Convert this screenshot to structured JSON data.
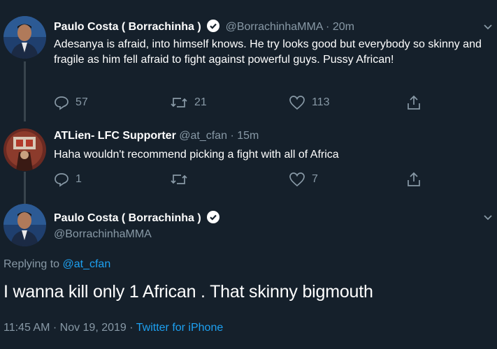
{
  "tweet1": {
    "name": "Paulo Costa ( Borrachinha )",
    "handle": "@BorrachinhaMMA",
    "dot": "·",
    "time": "20m",
    "text": "Adesanya is afraid, into himself knows. He try looks good but everybody so skinny and fragile as him fell afraid to fight against powerful guys. Pussy African!",
    "replies": "57",
    "retweets": "21",
    "likes": "113"
  },
  "tweet2": {
    "name": "ATLien- LFC Supporter",
    "handle": "@at_cfan",
    "dot": "·",
    "time": "15m",
    "text": "Haha wouldn't recommend picking a fight with all of Africa",
    "replies": "1",
    "retweets": "",
    "likes": "7"
  },
  "tweet3": {
    "name": "Paulo Costa ( Borrachinha )",
    "handle": "@BorrachinhaMMA",
    "replying_prefix": "Replying to ",
    "replying_handle": "@at_cfan",
    "text": "I wanna kill only 1 African . That skinny bigmouth",
    "timestamp": "11:45 AM · Nov 19, 2019 · ",
    "source": "Twitter for iPhone"
  },
  "colors": {
    "background": "#15202b",
    "secondary_text": "#8899a6",
    "accent": "#1da1f2",
    "divider": "#38444d"
  },
  "icons": [
    "reply-icon",
    "retweet-icon",
    "like-icon",
    "share-icon",
    "verified-badge-icon",
    "chevron-down-icon"
  ]
}
